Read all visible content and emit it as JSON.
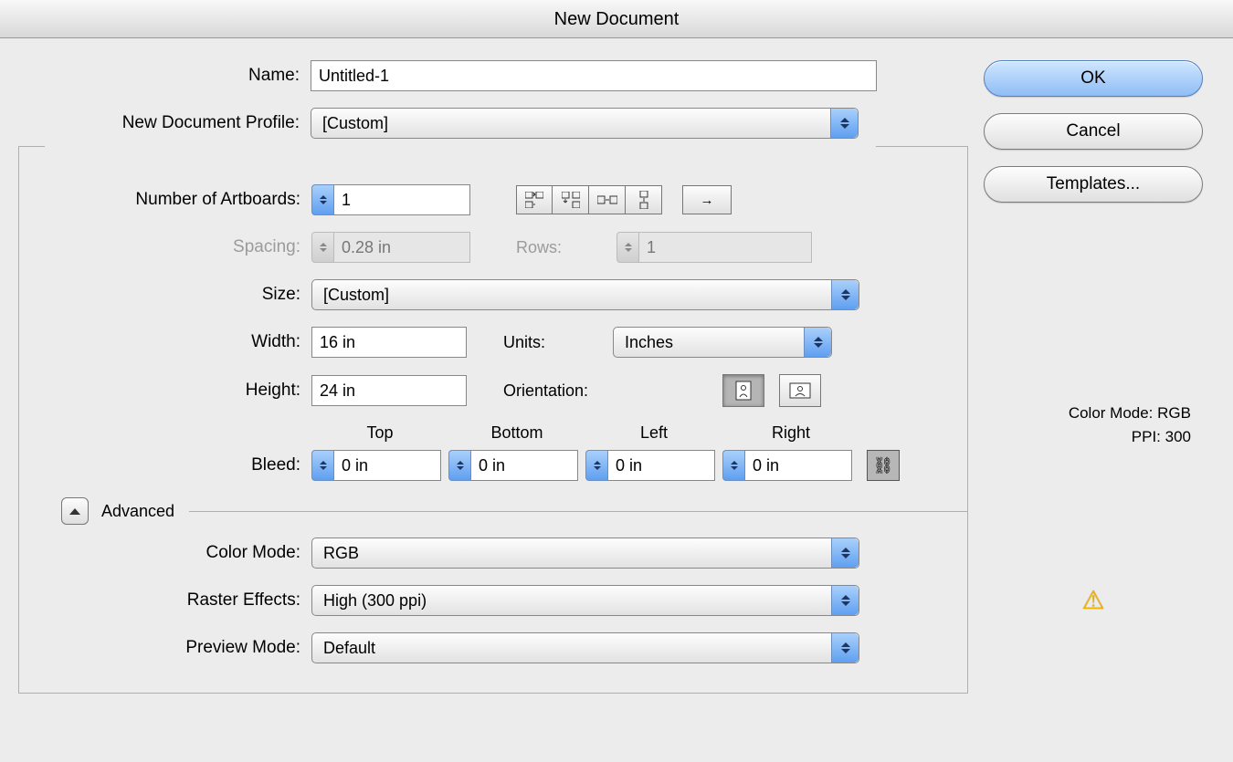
{
  "title": "New Document",
  "labels": {
    "name": "Name:",
    "profile": "New Document Profile:",
    "artboards": "Number of Artboards:",
    "spacing": "Spacing:",
    "rows": "Rows:",
    "size": "Size:",
    "width": "Width:",
    "height": "Height:",
    "units": "Units:",
    "orientation": "Orientation:",
    "bleed": "Bleed:",
    "advanced": "Advanced",
    "color_mode": "Color Mode:",
    "raster": "Raster Effects:",
    "preview": "Preview Mode:",
    "bleed_top": "Top",
    "bleed_bottom": "Bottom",
    "bleed_left": "Left",
    "bleed_right": "Right"
  },
  "values": {
    "name": "Untitled-1",
    "profile": "[Custom]",
    "artboards": "1",
    "spacing": "0.28 in",
    "rows": "1",
    "size": "[Custom]",
    "width": "16 in",
    "height": "24 in",
    "units": "Inches",
    "bleed_top": "0 in",
    "bleed_bottom": "0 in",
    "bleed_left": "0 in",
    "bleed_right": "0 in",
    "color_mode": "RGB",
    "raster": "High (300 ppi)",
    "preview": "Default"
  },
  "buttons": {
    "ok": "OK",
    "cancel": "Cancel",
    "templates": "Templates..."
  },
  "info": {
    "mode_label": "Color Mode:",
    "mode_value": "RGB",
    "ppi_label": "PPI:",
    "ppi_value": "300"
  }
}
